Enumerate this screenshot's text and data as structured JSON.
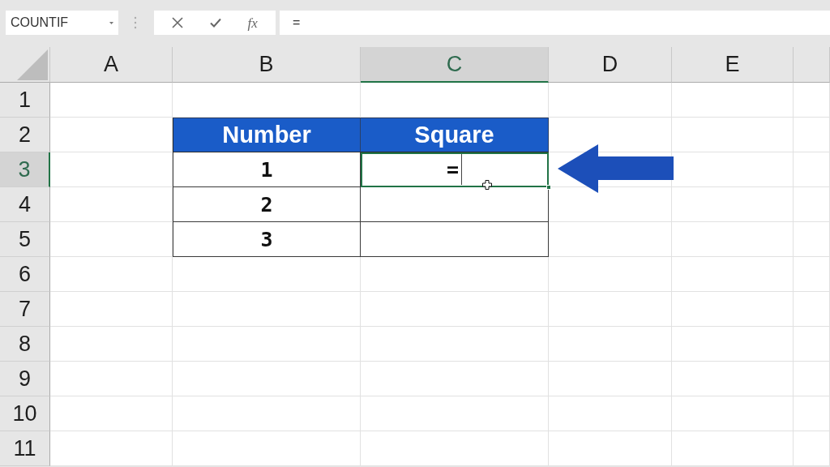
{
  "name_box": {
    "value": "COUNTIF"
  },
  "formula_bar": {
    "function_label": "fx",
    "value": "="
  },
  "columns": [
    {
      "label": "A",
      "selected": false
    },
    {
      "label": "B",
      "selected": false
    },
    {
      "label": "C",
      "selected": true
    },
    {
      "label": "D",
      "selected": false
    },
    {
      "label": "E",
      "selected": false
    }
  ],
  "rows": [
    {
      "label": "1",
      "selected": false
    },
    {
      "label": "2",
      "selected": false
    },
    {
      "label": "3",
      "selected": true
    },
    {
      "label": "4",
      "selected": false
    },
    {
      "label": "5",
      "selected": false
    },
    {
      "label": "6",
      "selected": false
    },
    {
      "label": "7",
      "selected": false
    },
    {
      "label": "8",
      "selected": false
    },
    {
      "label": "9",
      "selected": false
    },
    {
      "label": "10",
      "selected": false
    },
    {
      "label": "11",
      "selected": false
    }
  ],
  "table": {
    "header": [
      "Number",
      "Square"
    ],
    "rows": [
      {
        "cells": [
          {
            "value": "1",
            "selected": false,
            "editing": false
          },
          {
            "value": "=",
            "selected": true,
            "editing": true
          }
        ]
      },
      {
        "cells": [
          {
            "value": "2",
            "selected": false,
            "editing": false
          },
          {
            "selected": false,
            "editing": false
          }
        ]
      },
      {
        "cells": [
          {
            "value": "3",
            "selected": false,
            "editing": false
          },
          {
            "selected": false,
            "editing": false
          }
        ]
      }
    ]
  }
}
